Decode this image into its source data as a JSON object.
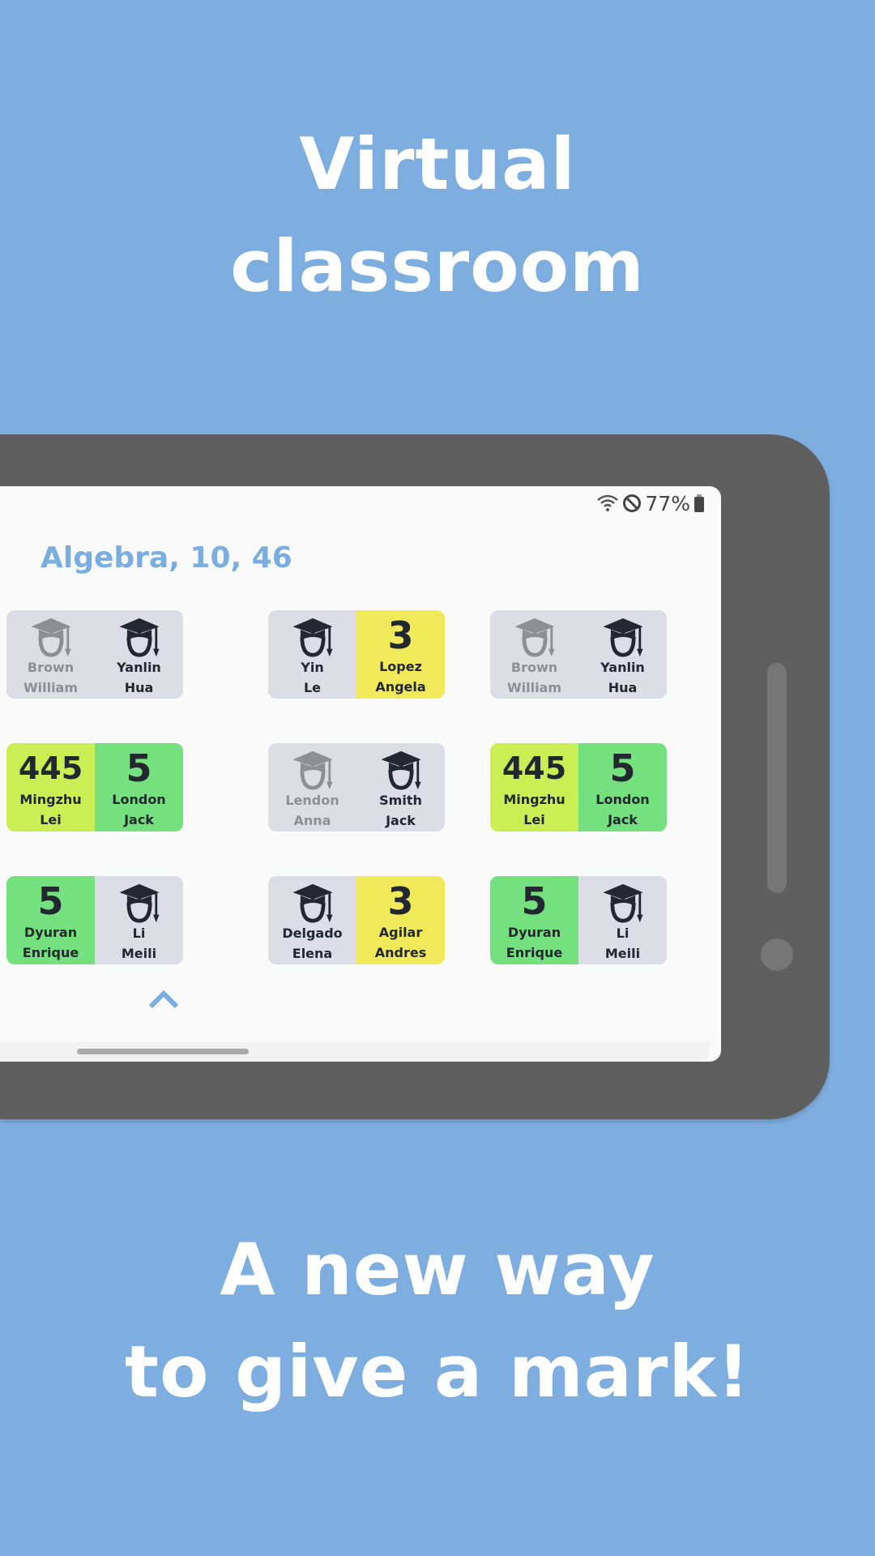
{
  "promo": {
    "top_line1": "Virtual",
    "top_line2": "classroom",
    "bottom_line1": "A new way",
    "bottom_line2": "to give a mark!"
  },
  "status_bar": {
    "battery": "77%",
    "icons": [
      "wifi-icon",
      "do-not-disturb-icon",
      "battery-icon"
    ]
  },
  "class_title": "Algebra, 10, 46",
  "colors": {
    "background": "#7eaee0",
    "phone": "#5f5f5f",
    "card_default": "#dcdde5",
    "mark_3": "#f0e95a",
    "mark_5": "#74e07e",
    "mark_mixed": "#c9ef55",
    "accent": "#7aaee0"
  },
  "desks": [
    {
      "column": 1,
      "row": 1,
      "seats": [
        {
          "last": "Brown",
          "first": "William",
          "absent": true
        },
        {
          "last": "Yanlin",
          "first": "Hua"
        }
      ]
    },
    {
      "column": 1,
      "row": 2,
      "seats": [
        {
          "last": "Mingzhu",
          "first": "Lei",
          "mark": "445"
        },
        {
          "last": "London",
          "first": "Jack",
          "mark": "5"
        }
      ]
    },
    {
      "column": 1,
      "row": 3,
      "seats": [
        {
          "last": "Dyuran",
          "first": "Enrique",
          "mark": "5"
        },
        {
          "last": "Li",
          "first": "Meili"
        }
      ]
    },
    {
      "column": 2,
      "row": 1,
      "seats": [
        {
          "last": "Yin",
          "first": "Le"
        },
        {
          "last": "Lopez",
          "first": "Angela",
          "mark": "3"
        }
      ]
    },
    {
      "column": 2,
      "row": 2,
      "seats": [
        {
          "last": "Lendon",
          "first": "Anna",
          "absent": true
        },
        {
          "last": "Smith",
          "first": "Jack"
        }
      ]
    },
    {
      "column": 2,
      "row": 3,
      "seats": [
        {
          "last": "Delgado",
          "first": "Elena"
        },
        {
          "last": "Agilar",
          "first": "Andres",
          "mark": "3"
        }
      ]
    },
    {
      "column": 3,
      "row": 1,
      "seats": [
        {
          "last": "Brown",
          "first": "William",
          "absent": true
        },
        {
          "last": "Yanlin",
          "first": "Hua"
        }
      ]
    },
    {
      "column": 3,
      "row": 2,
      "seats": [
        {
          "last": "Mingzhu",
          "first": "Lei",
          "mark": "445"
        },
        {
          "last": "London",
          "first": "Jack",
          "mark": "5"
        }
      ]
    },
    {
      "column": 3,
      "row": 3,
      "seats": [
        {
          "last": "Dyuran",
          "first": "Enrique",
          "mark": "5"
        },
        {
          "last": "Li",
          "first": "Meili"
        }
      ]
    }
  ]
}
